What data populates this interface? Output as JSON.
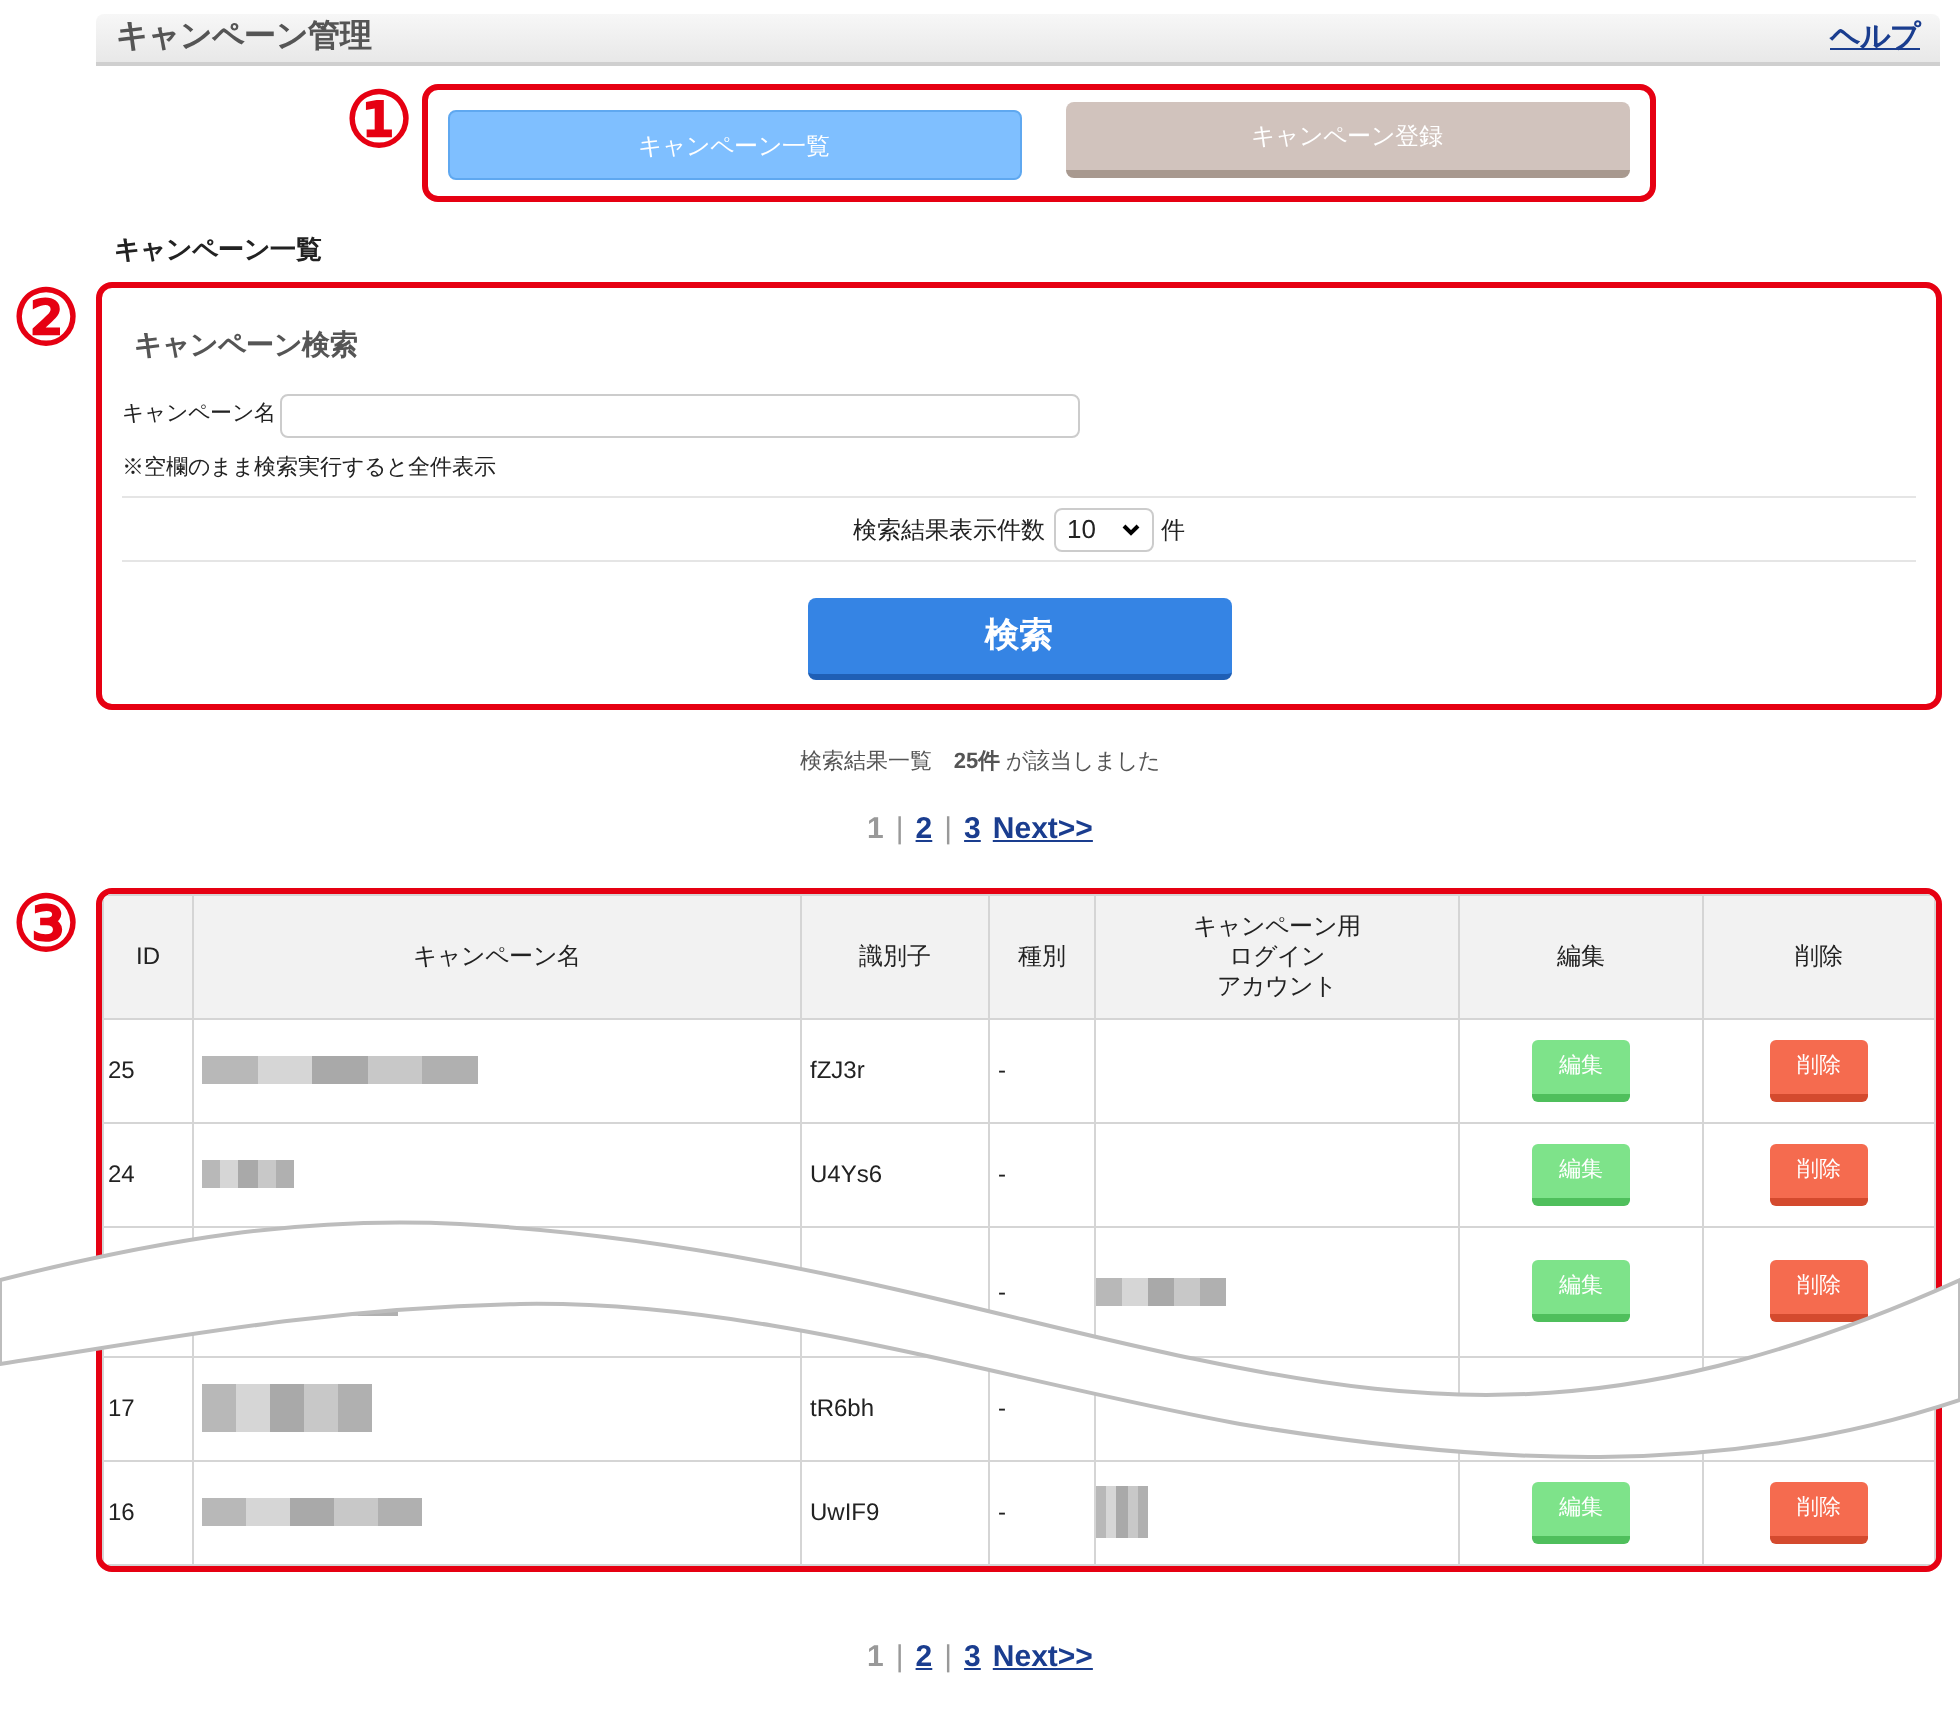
{
  "header": {
    "title": "キャンペーン管理",
    "help_link": "ヘルプ"
  },
  "tabs_section": {
    "marker": "①",
    "tabs": [
      {
        "label": "キャンペーン一覧",
        "selected": true
      },
      {
        "label": "キャンペーン登録",
        "selected": false
      }
    ]
  },
  "list_heading": "キャンペーン一覧",
  "search_section": {
    "marker": "②",
    "title": "キャンペーン検索",
    "name_label": "キャンペーン名",
    "note": "※空欄のまま検索実行すると全件表示",
    "count_label": "検索結果表示件数",
    "count_value": "10",
    "count_suffix": "件",
    "button": "検索"
  },
  "result_summary": "検索結果一覧　**25件** が該当しました",
  "pagination_top": {
    "separator": "|",
    "pages": [
      {
        "label": "1",
        "selected": true
      },
      {
        "label": "2",
        "selected": false
      },
      {
        "label": "3",
        "selected": false
      }
    ],
    "next": "Next>>"
  },
  "table_section": {
    "marker": "③",
    "columns": [
      "ID",
      "キャンペーン名",
      "識別子",
      "種別",
      [
        "キャンペーン用",
        "ログイン",
        "アカウント"
      ],
      "編集",
      "削除"
    ],
    "rows": [
      {
        "id": "25",
        "name_blurred": true,
        "identifier": "fZJ3r",
        "kind": "-",
        "account_blurred": false,
        "edit": "編集",
        "delete": "削除"
      },
      {
        "id": "24",
        "name_blurred": true,
        "identifier": "U4Ys6",
        "kind": "-",
        "account_blurred": false,
        "edit": "編集",
        "delete": "削除"
      },
      {
        "name_blurred": true,
        "kind": "-",
        "account_blurred": true,
        "edit": "編集",
        "delete": "削除"
      },
      {
        "id": "17",
        "name_blurred": true,
        "identifier": "tR6bh",
        "kind": "-",
        "account_blurred": false
      },
      {
        "id": "16",
        "name_blurred": true,
        "identifier": "UwIF9",
        "kind": "-",
        "account_blurred": true,
        "edit": "編集",
        "delete": "削除"
      }
    ]
  },
  "pagination_bottom": {
    "separator": "|",
    "pages": [
      {
        "label": "1",
        "selected": true
      },
      {
        "label": "2",
        "selected": false
      },
      {
        "label": "3",
        "selected": false
      }
    ],
    "next": "Next>>"
  }
}
